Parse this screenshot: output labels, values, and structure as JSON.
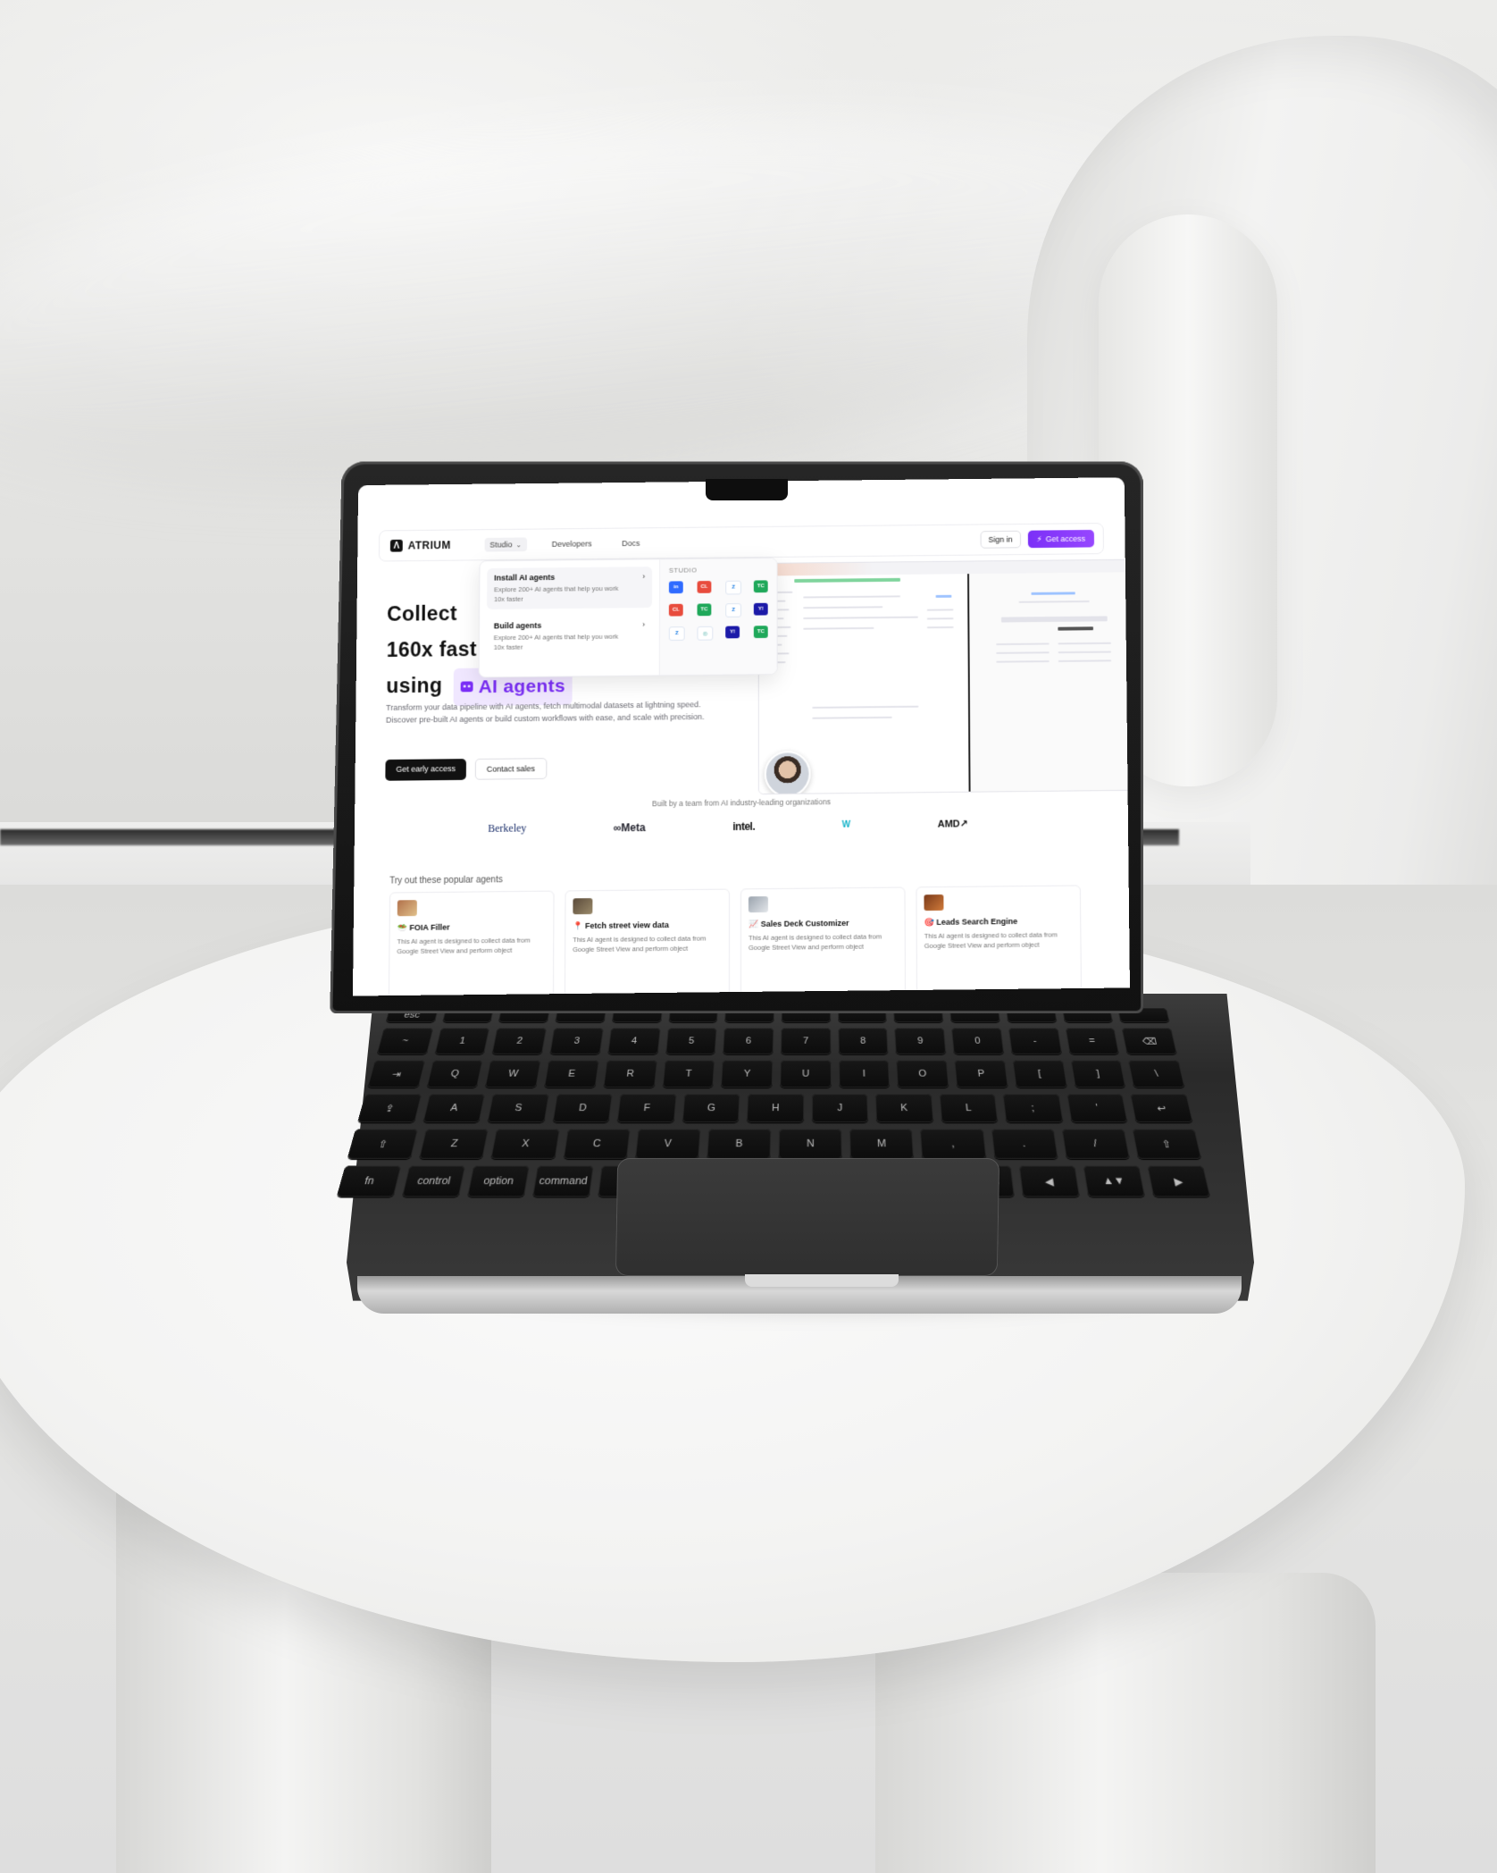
{
  "brand": {
    "name": "ATRIUM",
    "logo_glyph": "Λ"
  },
  "nav": {
    "items": [
      {
        "label": "Studio",
        "active": true
      },
      {
        "label": "Developers",
        "active": false
      },
      {
        "label": "Docs",
        "active": false
      }
    ],
    "signin_label": "Sign in",
    "access_label": "Get access"
  },
  "dropdown": {
    "items": [
      {
        "title": "Install AI agents",
        "desc": "Explore 200+ AI agents that help you work 10x faster"
      },
      {
        "title": "Build agents",
        "desc": "Explore 200+ AI agents that help you work 10x faster"
      }
    ],
    "section_label": "STUDIO",
    "icons": [
      {
        "name": "linkedin-icon",
        "style": "blue",
        "text": "in"
      },
      {
        "name": "craigslist-icon",
        "style": "red",
        "text": "CL"
      },
      {
        "name": "zillow-icon",
        "style": "zil",
        "text": "Z"
      },
      {
        "name": "tc-icon",
        "style": "green",
        "text": "TC"
      },
      {
        "name": "craigslist-icon",
        "style": "red",
        "text": "CL"
      },
      {
        "name": "tc-icon",
        "style": "green",
        "text": "TC"
      },
      {
        "name": "zillow-icon",
        "style": "zil",
        "text": "Z"
      },
      {
        "name": "yahoo-icon",
        "style": "navy",
        "text": "Y!"
      },
      {
        "name": "zillow-icon",
        "style": "zil",
        "text": "Z"
      },
      {
        "name": "copilot-icon",
        "style": "cp",
        "text": "◎"
      },
      {
        "name": "yahoo-icon",
        "style": "navy",
        "text": "Y!"
      },
      {
        "name": "tc-icon",
        "style": "green",
        "text": "TC"
      }
    ]
  },
  "hero": {
    "title_line1": "Collect",
    "title_line2": "160x fast",
    "title_line3_prefix": "using",
    "title_highlight": "AI agents",
    "description": "Transform your data pipeline with AI agents, fetch multimodal datasets at lightning speed. Discover pre-built AI agents or build custom workflows with ease, and scale with precision.",
    "primary_cta": "Get early access",
    "secondary_cta": "Contact sales"
  },
  "trust": {
    "label": "Built by a team from AI industry-leading organizations",
    "logos": [
      "Berkeley",
      "∞Meta",
      "intel.",
      "W",
      "AMD↗"
    ]
  },
  "popular": {
    "title": "Try out these popular agents",
    "cards": [
      {
        "emoji": "🥗",
        "title": "FOIA Filler",
        "desc": "This AI agent is designed to collect data from Google Street View and perform object"
      },
      {
        "emoji": "📍",
        "title": "Fetch street view data",
        "desc": "This AI agent is designed to collect data from Google Street View and perform object"
      },
      {
        "emoji": "📈",
        "title": "Sales Deck Customizer",
        "desc": "This AI agent is designed to collect data from Google Street View and perform object"
      },
      {
        "emoji": "🎯",
        "title": "Leads Search Engine",
        "desc": "This AI agent is designed to collect data from Google Street View and perform object"
      }
    ]
  },
  "keyboard": {
    "row1": [
      "esc",
      "",
      "",
      "",
      "",
      "",
      "",
      "",
      "",
      "",
      "",
      "",
      "",
      ""
    ],
    "row2": [
      "~",
      "1",
      "2",
      "3",
      "4",
      "5",
      "6",
      "7",
      "8",
      "9",
      "0",
      "-",
      "=",
      "⌫"
    ],
    "row3": [
      "⇥",
      "Q",
      "W",
      "E",
      "R",
      "T",
      "Y",
      "U",
      "I",
      "O",
      "P",
      "[",
      "]",
      "\\"
    ],
    "row4": [
      "⇪",
      "A",
      "S",
      "D",
      "F",
      "G",
      "H",
      "J",
      "K",
      "L",
      ";",
      "'",
      "↩"
    ],
    "row5": [
      "⇧",
      "Z",
      "X",
      "C",
      "V",
      "B",
      "N",
      "M",
      ",",
      ".",
      "/",
      "⇧"
    ],
    "row6": [
      "fn",
      "control",
      "option",
      "command",
      "",
      "command",
      "option",
      "◀",
      "▲▼",
      "▶"
    ]
  },
  "colors": {
    "accent": "#7b2ff7",
    "highlight_bg": "#f0e7ff"
  }
}
